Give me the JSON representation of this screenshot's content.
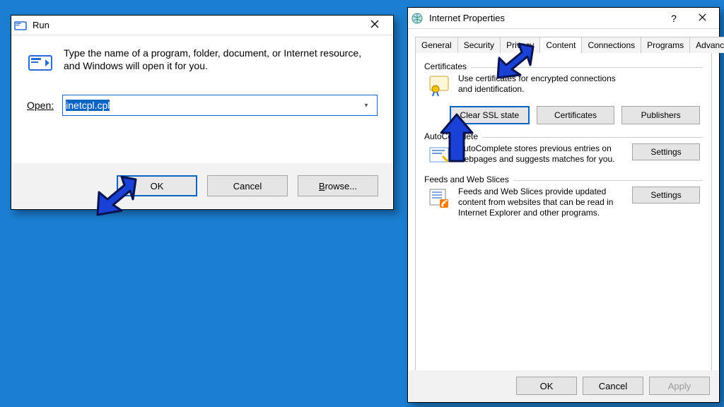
{
  "run": {
    "title": "Run",
    "message": "Type the name of a program, folder, document, or Internet resource, and Windows will open it for you.",
    "open_label": "Open:",
    "input_value": "inetcpl.cpl",
    "buttons": {
      "ok": "OK",
      "cancel": "Cancel",
      "browse": "Browse..."
    }
  },
  "ip": {
    "title": "Internet Properties",
    "tabs": [
      "General",
      "Security",
      "Privacy",
      "Content",
      "Connections",
      "Programs",
      "Advanced"
    ],
    "active_tab": "Content",
    "certificates": {
      "legend": "Certificates",
      "text": "Use certificates for encrypted connections and identification.",
      "clear": "Clear SSL state",
      "cert": "Certificates",
      "pub": "Publishers"
    },
    "autocomplete": {
      "legend": "AutoComplete",
      "text": "AutoComplete stores previous entries on webpages and suggests matches for you.",
      "settings": "Settings"
    },
    "feeds": {
      "legend": "Feeds and Web Slices",
      "text": "Feeds and Web Slices provide updated content from websites that can be read in Internet Explorer and other programs.",
      "settings": "Settings"
    },
    "footer": {
      "ok": "OK",
      "cancel": "Cancel",
      "apply": "Apply"
    }
  },
  "colors": {
    "arrow_fill": "#1941d6",
    "arrow_stroke": "#08134f"
  }
}
